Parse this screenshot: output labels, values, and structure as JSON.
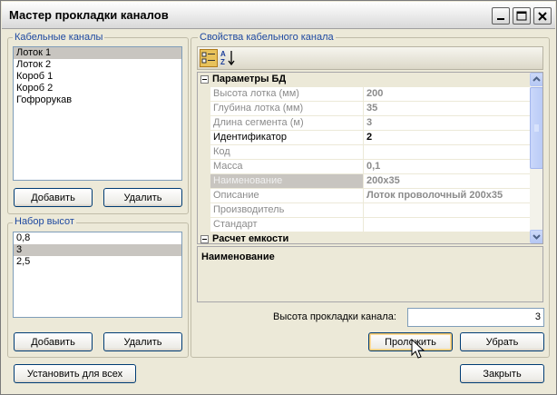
{
  "window": {
    "title": "Мастер прокладки каналов"
  },
  "cable_channels": {
    "title": "Кабельные каналы",
    "items": [
      "Лоток 1",
      "Лоток 2",
      "Короб 1",
      "Короб 2",
      "Гофрорукав"
    ],
    "selected_index": 0,
    "add_label": "Добавить",
    "delete_label": "Удалить"
  },
  "heights": {
    "title": "Набор высот",
    "items": [
      "0,8",
      "3",
      "2,5"
    ],
    "selected_index": 1,
    "add_label": "Добавить",
    "delete_label": "Удалить"
  },
  "properties": {
    "title": "Свойства кабельного канала",
    "category1": "Параметры БД",
    "rows": [
      {
        "name": "Высота лотка (мм)",
        "value": "200"
      },
      {
        "name": "Глубина лотка (мм)",
        "value": "35"
      },
      {
        "name": "Длина сегмента (м)",
        "value": "3"
      },
      {
        "name": "Идентификатор",
        "value": "2"
      },
      {
        "name": "Код",
        "value": ""
      },
      {
        "name": "Масса",
        "value": "0,1"
      },
      {
        "name": "Наименование",
        "value": "200x35"
      },
      {
        "name": "Описание",
        "value": "Лоток проволочный 200x35"
      },
      {
        "name": "Производитель",
        "value": ""
      },
      {
        "name": "Стандарт",
        "value": ""
      }
    ],
    "category2": "Расчет емкости",
    "description_title": "Наименование"
  },
  "height_field": {
    "label": "Высота прокладки канала:",
    "value": "3"
  },
  "buttons": {
    "lay": "Проложить",
    "remove": "Убрать",
    "set_all": "Установить для всех",
    "close": "Закрыть"
  }
}
